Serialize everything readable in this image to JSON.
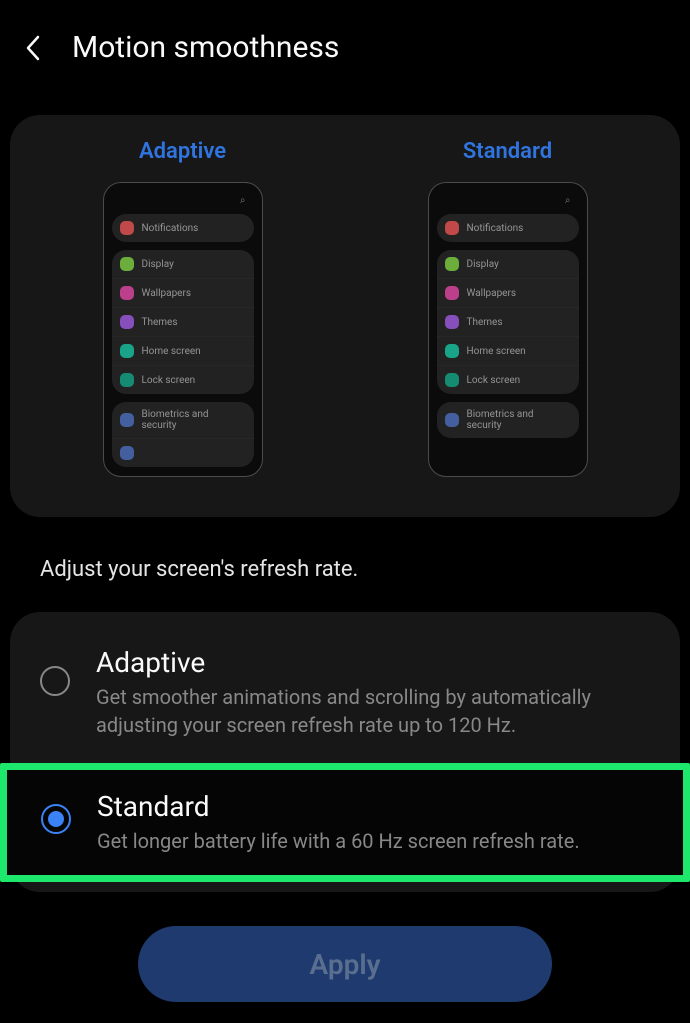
{
  "header": {
    "title": "Motion smoothness"
  },
  "preview": {
    "adaptive_label": "Adaptive",
    "standard_label": "Standard",
    "items": {
      "notifications": "Notifications",
      "display": "Display",
      "wallpapers": "Wallpapers",
      "themes": "Themes",
      "home_screen": "Home screen",
      "lock_screen": "Lock screen",
      "biometrics": "Biometrics and security"
    }
  },
  "section_label": "Adjust your screen's refresh rate.",
  "options": {
    "adaptive": {
      "title": "Adaptive",
      "desc": "Get smoother animations and scrolling by automatically adjusting your screen refresh rate up to 120 Hz.",
      "selected": false
    },
    "standard": {
      "title": "Standard",
      "desc": "Get longer battery life with a 60 Hz screen refresh rate.",
      "selected": true
    }
  },
  "apply_label": "Apply"
}
